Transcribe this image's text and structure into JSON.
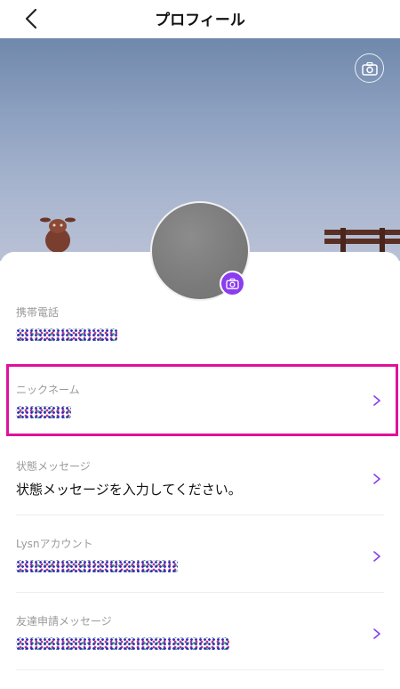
{
  "header": {
    "title": "プロフィール"
  },
  "icons": {
    "back": "chevron-left-icon",
    "cover_camera": "camera-icon",
    "avatar_camera": "camera-icon",
    "row_chevron": "chevron-right-icon"
  },
  "colors": {
    "accent": "#8a3df0",
    "highlight": "#e0119a",
    "label": "#9a9a9a"
  },
  "fields": [
    {
      "label": "携帯電話",
      "value": "",
      "masked": true
    },
    {
      "label": "ニックネーム",
      "value": "",
      "masked": true
    },
    {
      "label": "状態メッセージ",
      "value": "状態メッセージを入力してください。",
      "masked": false
    },
    {
      "label": "Lysnアカウント",
      "value": "",
      "masked": true
    },
    {
      "label": "友達申請メッセージ",
      "value": "",
      "masked": true
    }
  ]
}
